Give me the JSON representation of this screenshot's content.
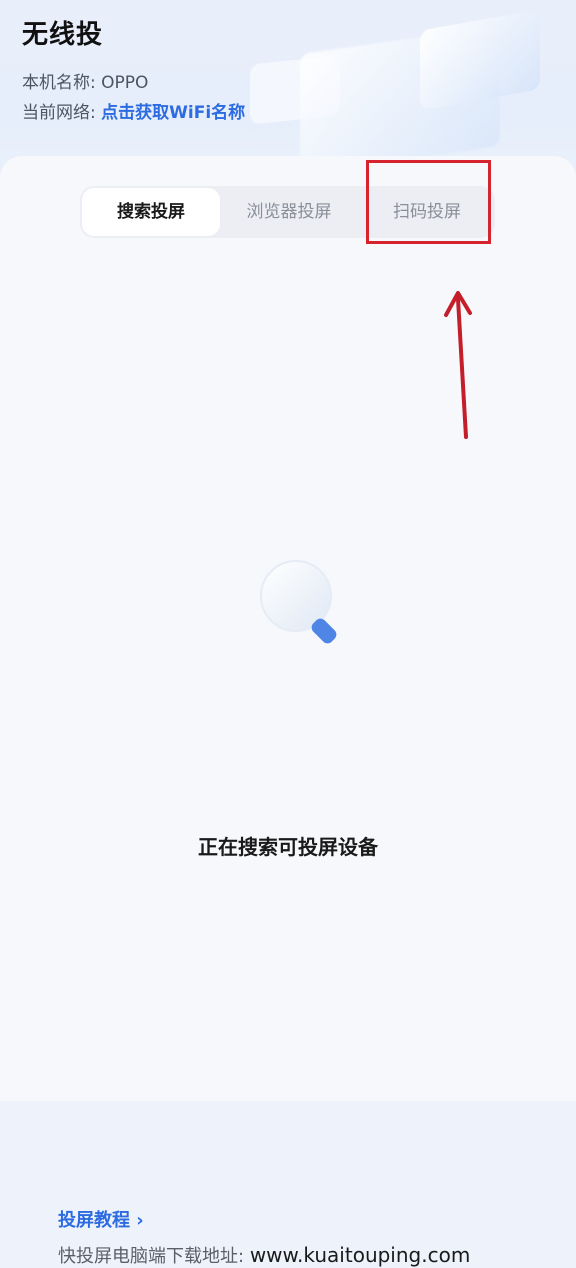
{
  "app": {
    "title": "无线投"
  },
  "device_info": {
    "name_label": "本机名称:",
    "name_value": "OPPO",
    "network_label": "当前网络:",
    "network_link": "点击获取WiFi名称"
  },
  "tabs": [
    {
      "label": "搜索投屏",
      "selected": true
    },
    {
      "label": "浏览器投屏",
      "selected": false
    },
    {
      "label": "扫码投屏",
      "selected": false
    }
  ],
  "main": {
    "status": "正在搜索可投屏设备",
    "icon": "search-icon"
  },
  "footer": {
    "tutorial_link": "投屏教程",
    "tutorial_chevron": "›",
    "download_label": "快投屏电脑端下载地址:",
    "download_url": "www.kuaitouping.com"
  },
  "colors": {
    "accent": "#2d6be0",
    "highlight": "#d6242f"
  }
}
